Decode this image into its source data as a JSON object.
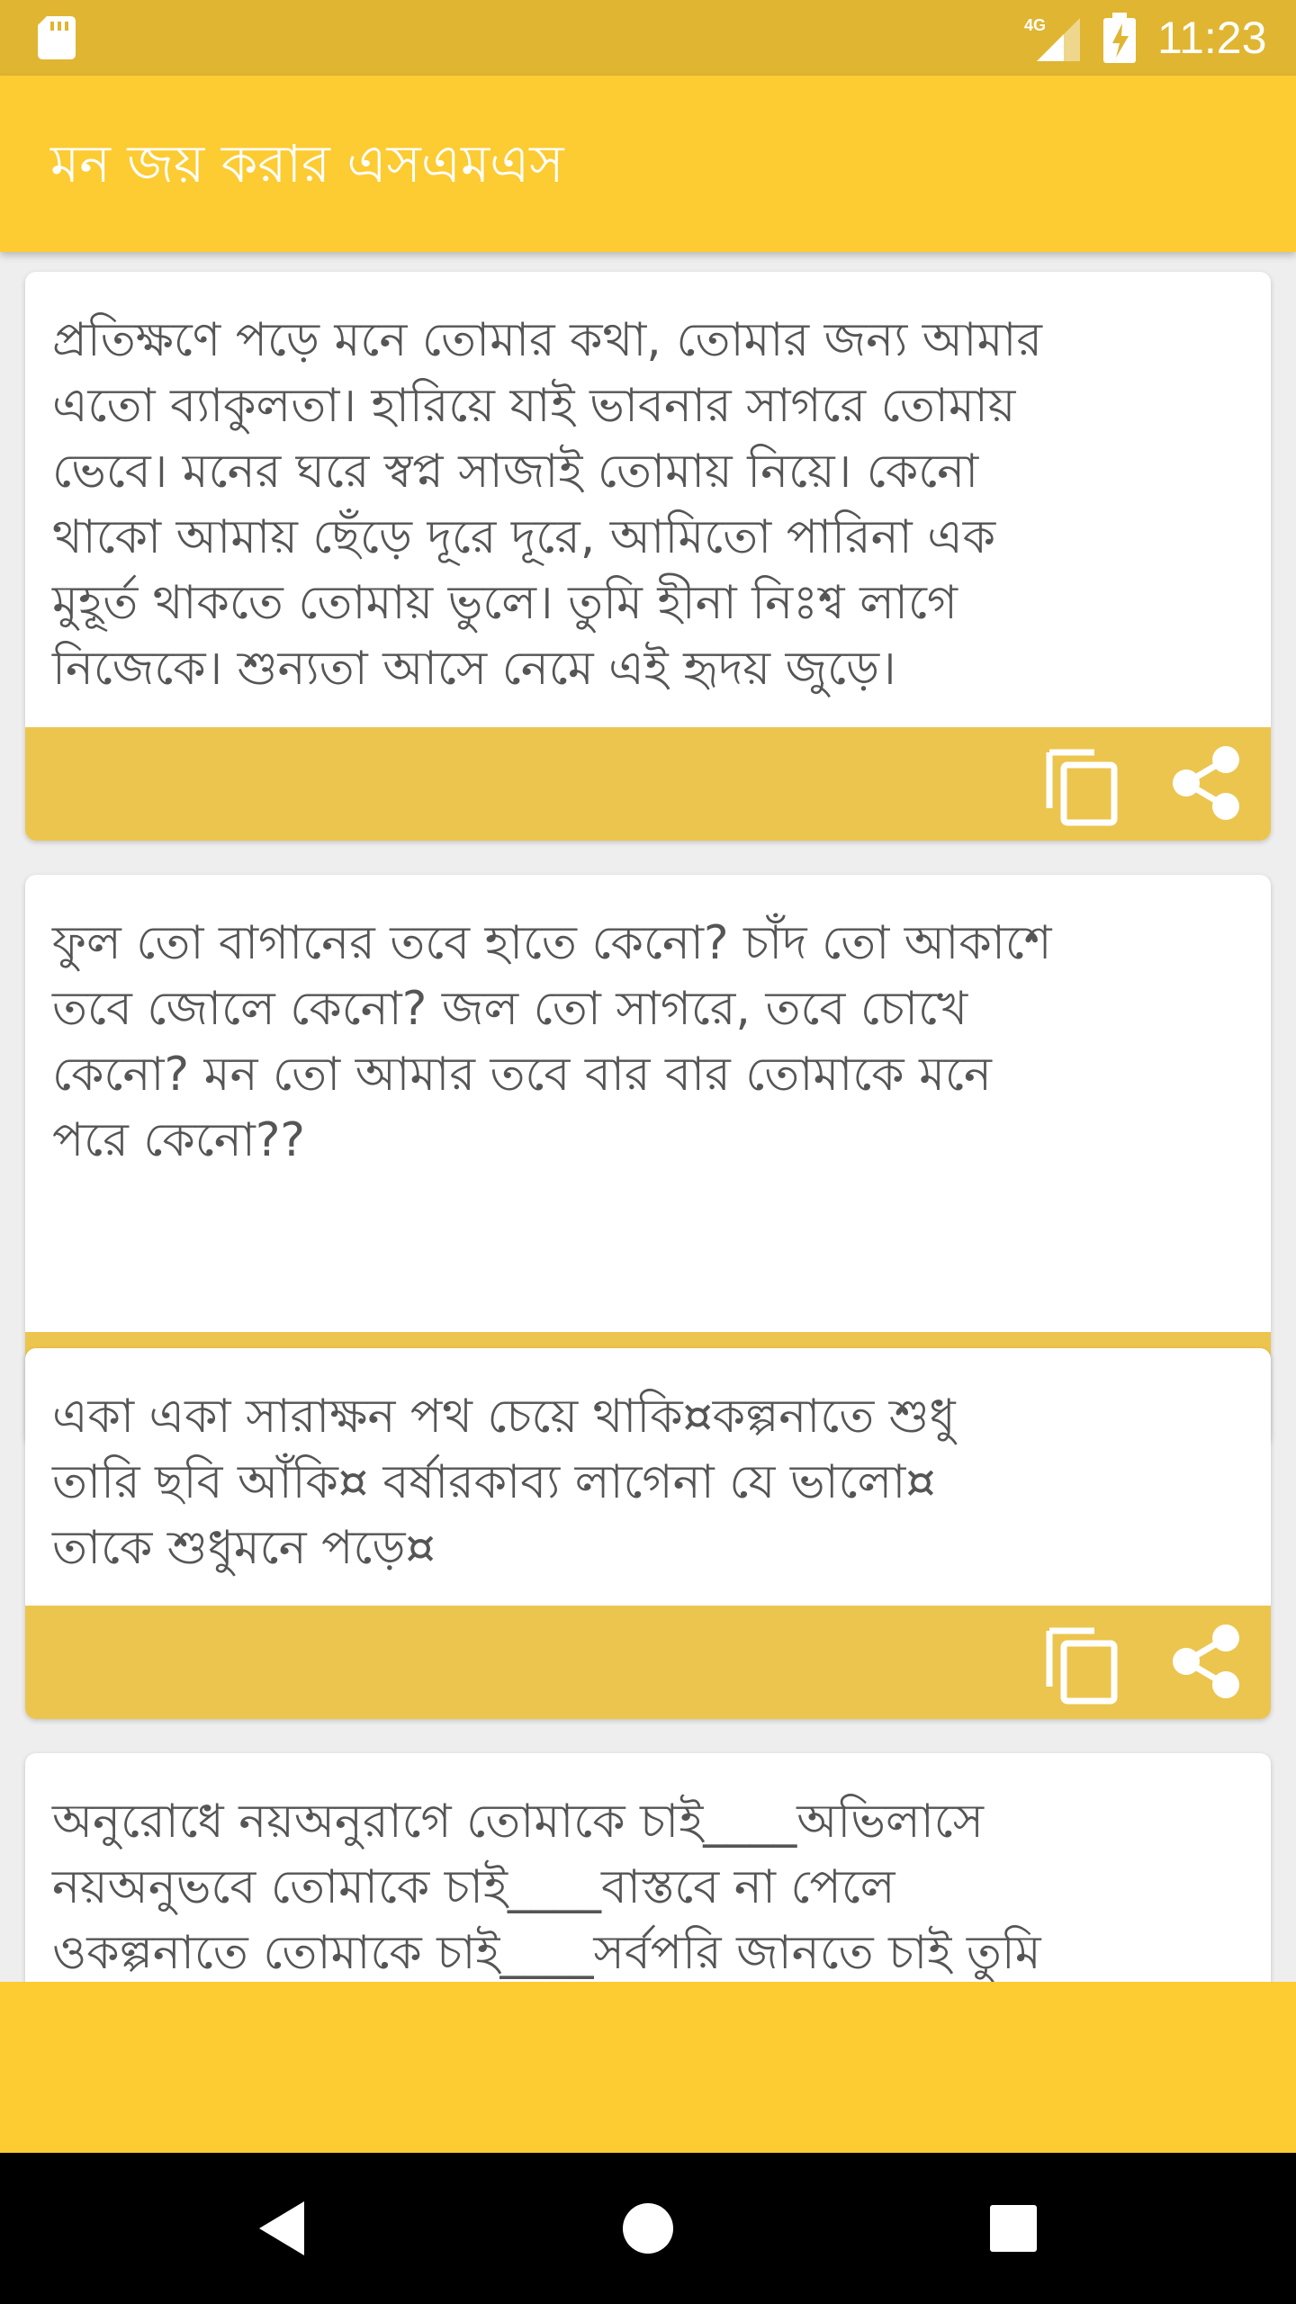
{
  "status_bar": {
    "time": "11:23",
    "network": "4G",
    "icons": [
      "sd-card-icon",
      "signal-icon",
      "battery-charging-icon"
    ]
  },
  "app_bar": {
    "title": "মন জয় করার এসএমএস"
  },
  "cards": [
    {
      "text": "প্রতিক্ষণে পড়ে মনে তোমার কথা, তোমার জন্য আমার\nএতো ব্যাকুলতা। হারিয়ে যাই ভাবনার সাগরে তোমায়\nভেবে। মনের ঘরে স্বপ্ন সাজাই তোমায় নিয়ে। কেনো\nথাকো আমায় ছেঁড়ে দূরে দূরে, আমিতো পারিনা এক\nমুহূর্ত থাকতে তোমায় ভুলে। তুমি হীনা নিঃশ্ব লাগে\nনিজেকে। শুন্যতা আসে নেমে এই হৃদয় জুড়ে।"
    },
    {
      "text": "ফুল তো বাগানের তবে হাতে কেনো? চাঁদ তো আকাশে\nতবে জোলে কেনো? জল তো সাগরে, তবে চোখে\nকেনো? মন তো আমার তবে বার বার তোমাকে মনে\nপরে কেনো??"
    },
    {
      "text": "একা একা সারাক্ষন পথ চেয়ে থাকি¤কল্পনাতে শুধু\nতারি ছবি আঁকি¤ বর্ষারকাব্য লাগেনা যে ভালো¤\nতাকে শুধুমনে পড়ে¤"
    },
    {
      "text": "অনুরোধে নয়অনুরাগে তোমাকে চাই____অভিলাসে\nনয়অনুভবে তোমাকে চাই____বাস্তবে না পেলে\nওকল্পনাতে তোমাকে চাই____সর্বপরি জানতে চাই তুমি"
    }
  ],
  "card_actions": {
    "copy_icon": "copy-icon",
    "share_icon": "share-icon"
  },
  "colors": {
    "status_bar": "#e0b531",
    "app_bar": "#fdcb32",
    "card_action_bar": "#ecc54f",
    "card_text": "#555555",
    "nav_bar": "#000000"
  },
  "nav_bar": {
    "buttons": [
      "back-icon",
      "home-icon",
      "recents-icon"
    ]
  }
}
